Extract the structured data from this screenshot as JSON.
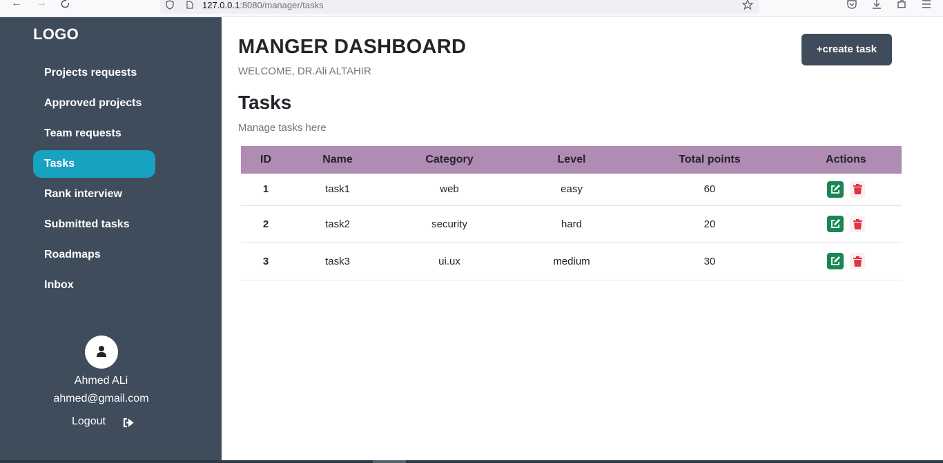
{
  "browser": {
    "url_host": "127.0.0.1",
    "url_rest": ":8080/manager/tasks"
  },
  "sidebar": {
    "logo": "LOGO",
    "items": [
      {
        "label": "Projects requests",
        "active": false
      },
      {
        "label": "Approved projects",
        "active": false
      },
      {
        "label": "Team requests",
        "active": false
      },
      {
        "label": "Tasks",
        "active": true
      },
      {
        "label": "Rank interview",
        "active": false
      },
      {
        "label": "Submitted tasks",
        "active": false
      },
      {
        "label": "Roadmaps",
        "active": false
      },
      {
        "label": "Inbox",
        "active": false
      }
    ],
    "profile": {
      "name": "Ahmed ALi",
      "email": "ahmed@gmail.com",
      "logout_label": "Logout"
    }
  },
  "main": {
    "title": "MANGER DASHBOARD",
    "welcome": "WELCOME, DR.Ali ALTAHIR",
    "create_button": "+create task",
    "section_title": "Tasks",
    "section_subtitle": "Manage tasks here",
    "table": {
      "columns": [
        "ID",
        "Name",
        "Category",
        "Level",
        "Total points",
        "Actions"
      ],
      "rows": [
        {
          "id": "1",
          "name": "task1",
          "category": "web",
          "level": "easy",
          "points": "60"
        },
        {
          "id": "2",
          "name": "task2",
          "category": "security",
          "level": "hard",
          "points": "20"
        },
        {
          "id": "3",
          "name": "task3",
          "category": "ui.ux",
          "level": "medium",
          "points": "30"
        }
      ]
    }
  },
  "colors": {
    "sidebar_bg": "#3f4c5c",
    "active_item": "#17a2c0",
    "table_header": "#b08bb3",
    "edit_green": "#198754",
    "delete_red": "#dc3545"
  }
}
